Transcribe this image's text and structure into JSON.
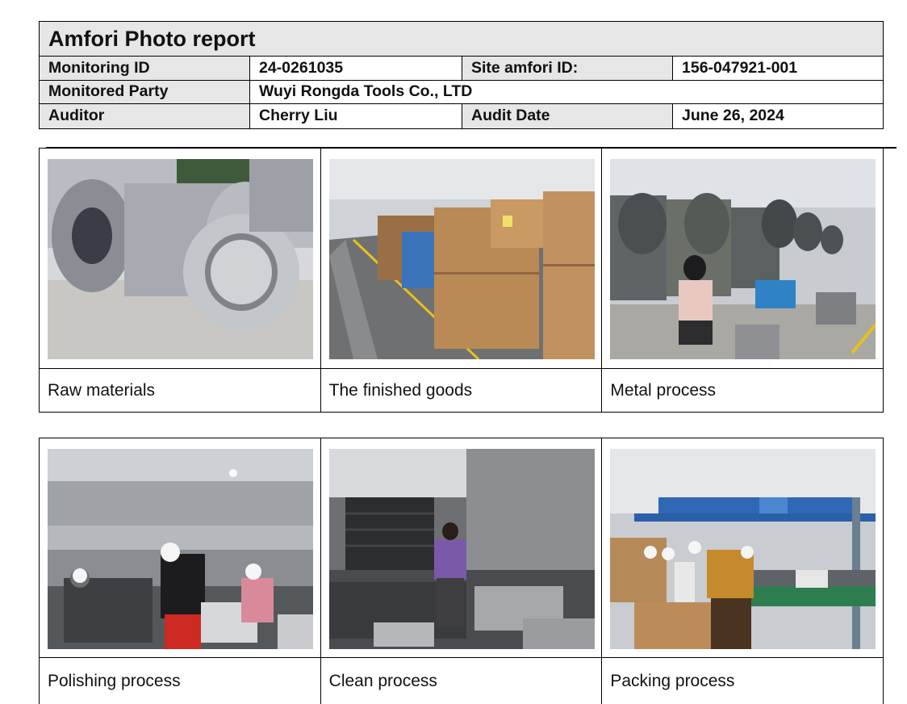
{
  "report": {
    "title": "Amfori Photo report",
    "rows": {
      "monitoring_id_label": "Monitoring ID",
      "monitoring_id_value": "24-0261035",
      "site_id_label": "Site amfori ID:",
      "site_id_value": "156-047921-001",
      "party_label": "Monitored Party",
      "party_value": "Wuyi Rongda Tools Co., LTD",
      "auditor_label": "Auditor",
      "auditor_value": "Cherry Liu",
      "date_label": "Audit Date",
      "date_value": "June 26, 2024"
    }
  },
  "photos": [
    {
      "caption": "Raw materials"
    },
    {
      "caption": "The finished goods"
    },
    {
      "caption": "Metal process"
    },
    {
      "caption": "Polishing process"
    },
    {
      "caption": "Clean process"
    },
    {
      "caption": "Packing process"
    }
  ]
}
